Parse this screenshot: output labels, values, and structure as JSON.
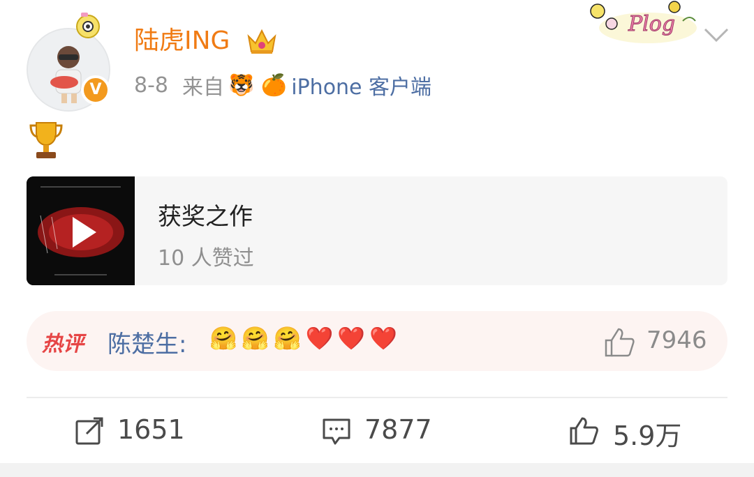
{
  "post": {
    "username": "陆虎ING",
    "date": "8-8",
    "from_label": "来自",
    "device_emojis": "🐯 🍊",
    "client": "iPhone 客户端",
    "body_emoji": "🏆"
  },
  "video_card": {
    "title": "获奖之作",
    "subtitle": "10 人赞过"
  },
  "hot_comment": {
    "tag": "热评",
    "user": "陈楚生:",
    "emojis": "🤗🤗🤗❤️❤️❤️",
    "likes": "7946"
  },
  "actions": {
    "repost_count": "1651",
    "comment_count": "7877",
    "like_count": "5.9万"
  },
  "colors": {
    "username": "#f07b14",
    "link_blue": "#4d6ea3",
    "hot_red": "#e64545",
    "verified_orange": "#f39a1e"
  },
  "icons": [
    "camera-badge-icon",
    "crown-icon",
    "verified-v-icon",
    "plog-sticker-icon",
    "chevron-down-icon",
    "trophy-icon",
    "play-icon",
    "thumbs-up-icon",
    "repost-icon",
    "comment-icon"
  ]
}
